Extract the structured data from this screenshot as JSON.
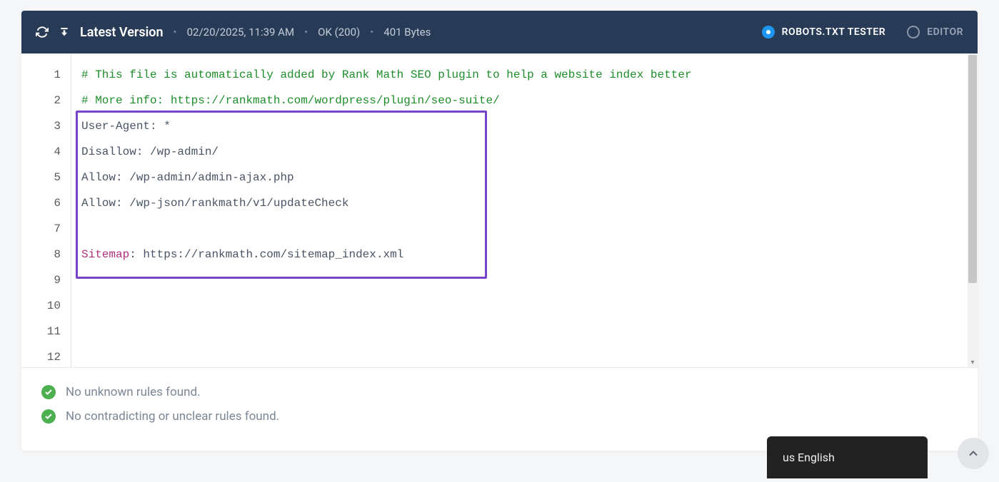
{
  "header": {
    "title": "Latest Version",
    "date": "02/20/2025, 11:39 AM",
    "status": "OK (200)",
    "size": "401 Bytes",
    "mode_tester": "ROBOTS.TXT TESTER",
    "mode_editor": "EDITOR"
  },
  "code": {
    "l1": "# This file is automatically added by Rank Math SEO plugin to help a website index better",
    "l2": "# More info: https://rankmath.com/wordpress/plugin/seo-suite/",
    "l3": "User-Agent: *",
    "l4": "Disallow: /wp-admin/",
    "l5": "Allow: /wp-admin/admin-ajax.php",
    "l6": "Allow: /wp-json/rankmath/v1/updateCheck",
    "l7": "",
    "l8_kw": "Sitemap",
    "l8_rest": ": https://rankmath.com/sitemap_index.xml",
    "l9": ""
  },
  "lines": {
    "n1": "1",
    "n2": "2",
    "n3": "3",
    "n4": "4",
    "n5": "5",
    "n6": "6",
    "n7": "7",
    "n8": "8",
    "n9": "9",
    "n10": "10",
    "n11": "11",
    "n12": "12"
  },
  "status": {
    "msg1": "No unknown rules found.",
    "msg2": "No contradicting or unclear rules found."
  },
  "lang": {
    "label": "us English"
  }
}
